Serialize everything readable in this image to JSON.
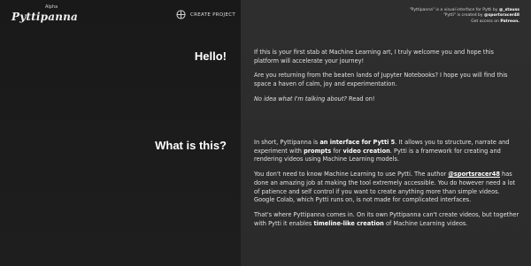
{
  "header": {
    "logo": "Pyttipanna",
    "logo_badge": "Alpha",
    "create_project_label": "CREATE PROJECT",
    "create_project_icon": "circle-plus-icon"
  },
  "credits": {
    "line1_pre": "\"Pyttipanna\" is a visual interface for Pytti by ",
    "line1_handle": "@_stauss",
    "line2_pre": "\"Pytti\" is created by ",
    "line2_handle": "@sportsracer48",
    "line3_pre": "Get access on ",
    "line3_link": "Patreon."
  },
  "hello": {
    "title": "Hello!",
    "p1": "If this is your first stab at Machine Learning art, I truly welcome you and hope this platform will accelerate your journey!",
    "p2": "Are you returning from the beaten lands of Jupyter Notebooks? I hope you will find this space a haven of calm, joy and experimentation.",
    "p3_italic": "No idea what I'm talking about?",
    "p3_rest": " Read on!"
  },
  "what": {
    "title": "What is this?",
    "p1_a": "In short, Pyttipanna is ",
    "p1_b": "an interface for Pytti 5",
    "p1_c": ". It allows you to structure, narrate and experiment with ",
    "p1_d": "prompts",
    "p1_e": " for ",
    "p1_f": "video creation",
    "p1_g": ". Pytti is a framework for creating and rendering videos using Machine Learning models.",
    "p2_a": "You don't need to know Machine Learning to use Pytti. The author ",
    "p2_handle": "@sportsracer48",
    "p2_b": " has done an amazing job at making the tool extremely accessible. You do however need a lot of patience and self control if you want to create anything more than simple videos. Google Colab, which Pytti runs on, is not made for complicated interfaces.",
    "p3_a": "That's where Pyttipanna comes in. On its own Pyttipanna can't create videos, but together with Pytti it enables ",
    "p3_b": "timeline-like creation",
    "p3_c": " of Machine Learning videos."
  }
}
